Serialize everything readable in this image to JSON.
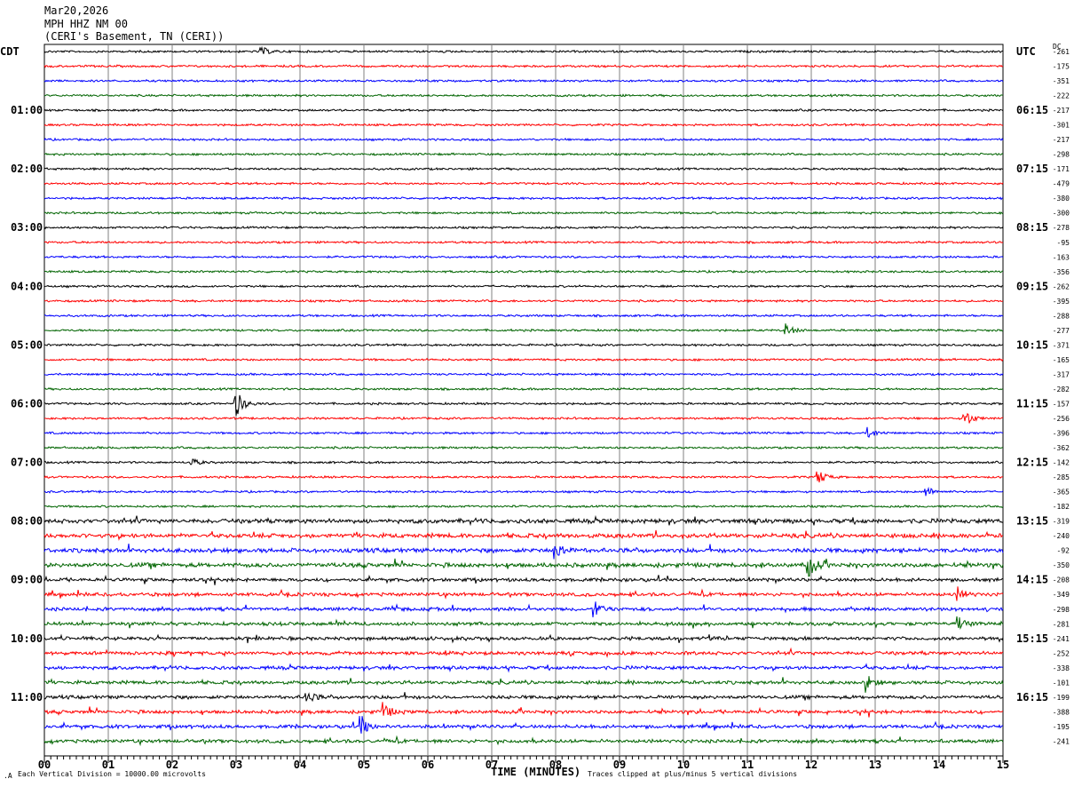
{
  "header": {
    "date": "Mar20,2026",
    "station": "MPH HHZ NM 00",
    "location": "(CERI's Basement, TN (CERI))"
  },
  "left_zone": "CDT",
  "right_zone": "UTC",
  "dc_label": "DC",
  "footer": {
    "scale": "Each Vertical Division = 10000.00 microvolts",
    "xlabel": "TIME (MINUTES)",
    "clip_note": "Traces clipped at plus/minus 5 vertical divisions"
  },
  "colors": {
    "trace_cycle": [
      "#000000",
      "#ff0000",
      "#0000ff",
      "#006400"
    ],
    "grid": "#808080"
  },
  "chart_data": {
    "type": "line",
    "subtype": "helicorder",
    "xlabel": "TIME (MINUTES)",
    "xlim": [
      0,
      15
    ],
    "x_ticks": [
      "00",
      "01",
      "02",
      "03",
      "04",
      "05",
      "06",
      "07",
      "08",
      "09",
      "10",
      "11",
      "12",
      "13",
      "14",
      "15"
    ],
    "rows_per_hour": 4,
    "left_hour_labels": [
      "CDT",
      "01:00",
      "02:00",
      "03:00",
      "04:00",
      "05:00",
      "06:00",
      "07:00",
      "08:00",
      "09:00",
      "10:00",
      "11:00"
    ],
    "right_hour_labels": [
      "",
      "06:15",
      "07:15",
      "08:15",
      "09:15",
      "10:15",
      "11:15",
      "12:15",
      "13:15",
      "14:15",
      "15:15",
      "16:15"
    ],
    "dc_offsets": [
      -261,
      -175,
      -351,
      -222,
      -217,
      -301,
      -217,
      -298,
      -171,
      -479,
      -380,
      -300,
      -278,
      -95,
      -163,
      -356,
      -262,
      -395,
      -288,
      -277,
      -371,
      -165,
      -317,
      -282,
      -157,
      -256,
      -396,
      -362,
      -142,
      -285,
      -365,
      -182,
      -319,
      -240,
      -92,
      -350,
      -208,
      -349,
      -298,
      -281,
      -241,
      -252,
      -338,
      -101,
      -199,
      -388,
      -195,
      -241
    ],
    "grid": true,
    "events": [
      {
        "row": 0,
        "minute": 3.4,
        "amplitude": 0.4
      },
      {
        "row": 19,
        "minute": 11.6,
        "amplitude": 0.6
      },
      {
        "row": 24,
        "minute": 3.0,
        "amplitude": 1.3
      },
      {
        "row": 25,
        "minute": 14.4,
        "amplitude": 0.9
      },
      {
        "row": 26,
        "minute": 12.9,
        "amplitude": 0.5
      },
      {
        "row": 28,
        "minute": 2.3,
        "amplitude": 0.4
      },
      {
        "row": 29,
        "minute": 12.1,
        "amplitude": 0.8
      },
      {
        "row": 30,
        "minute": 13.8,
        "amplitude": 0.5
      },
      {
        "row": 34,
        "minute": 8.0,
        "amplitude": 1.0
      },
      {
        "row": 35,
        "minute": 11.95,
        "amplitude": 1.1
      },
      {
        "row": 37,
        "minute": 14.3,
        "amplitude": 0.6
      },
      {
        "row": 38,
        "minute": 8.6,
        "amplitude": 0.8
      },
      {
        "row": 39,
        "minute": 14.3,
        "amplitude": 0.6
      },
      {
        "row": 43,
        "minute": 12.85,
        "amplitude": 0.8
      },
      {
        "row": 44,
        "minute": 4.1,
        "amplitude": 0.6
      },
      {
        "row": 45,
        "minute": 5.3,
        "amplitude": 0.8
      },
      {
        "row": 46,
        "minute": 4.95,
        "amplitude": 1.0
      }
    ]
  }
}
